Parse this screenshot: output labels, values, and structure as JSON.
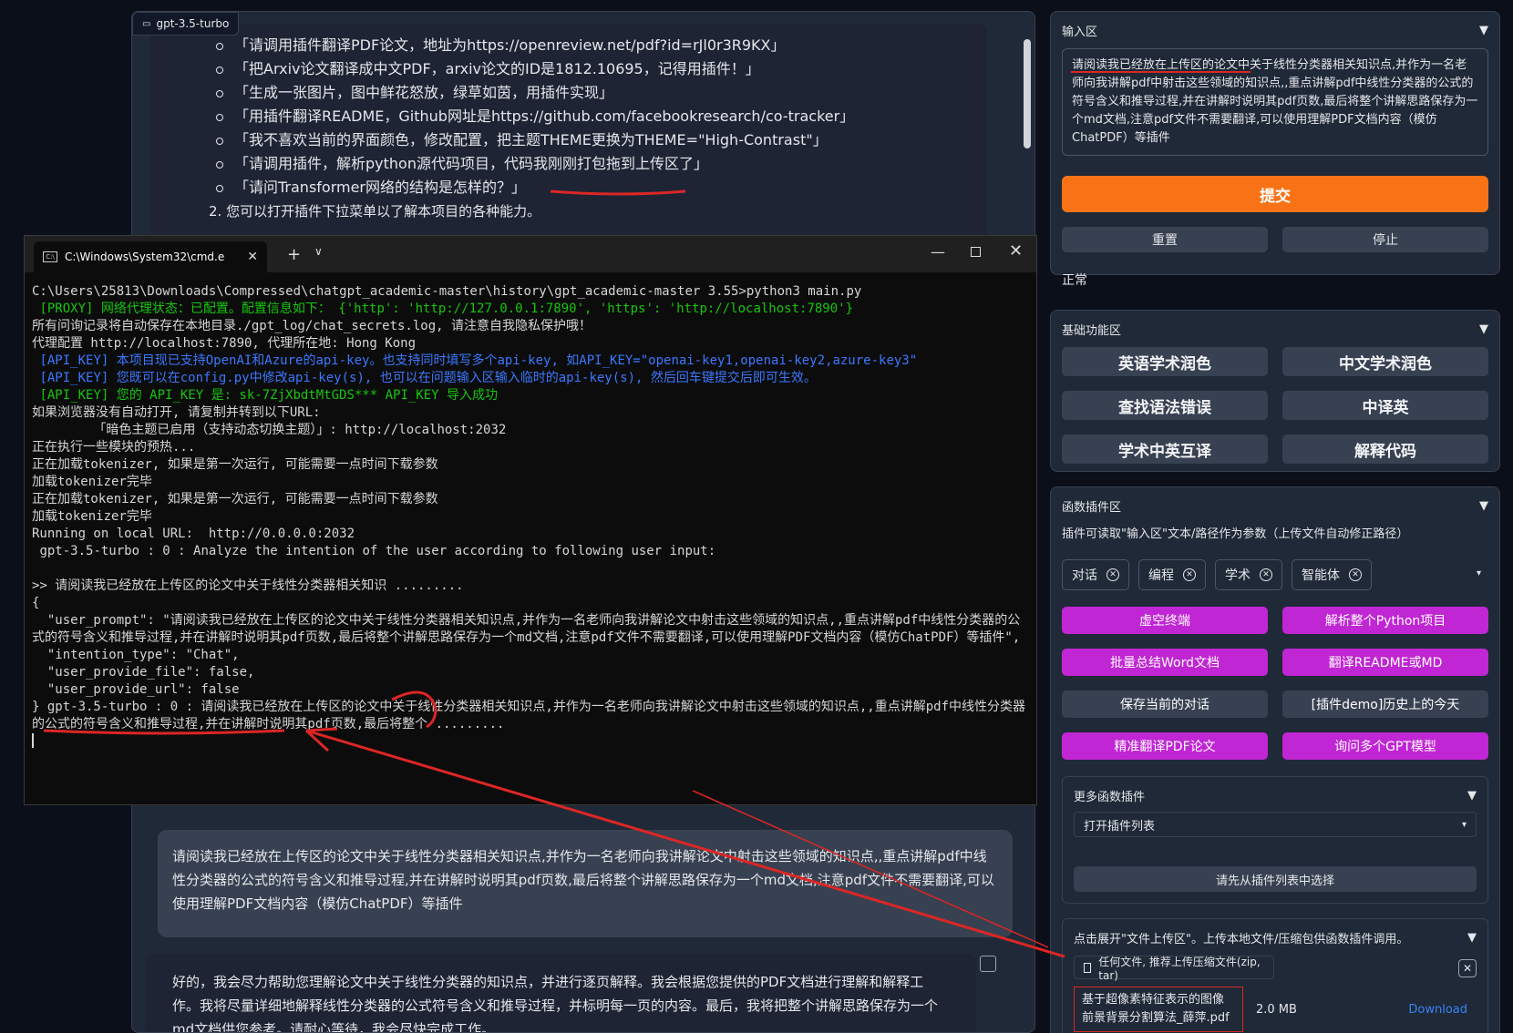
{
  "chat": {
    "label": "gpt-3.5-turbo",
    "examples": [
      "「请调用插件翻译PDF论文，地址为https://openreview.net/pdf?id=rJl0r3R9KX」",
      "「把Arxiv论文翻译成中文PDF，arxiv论文的ID是1812.10695，记得用插件！」",
      "「生成一张图片，图中鲜花怒放，绿草如茵，用插件实现」",
      "「用插件翻译README，Github网址是https://github.com/facebookresearch/co-tracker」",
      "「我不喜欢当前的界面颜色，修改配置，把主题THEME更换为THEME=\"High-Contrast\"」",
      "「请调用插件，解析python源代码项目，代码我刚刚打包拖到上传区了」",
      "「请问Transformer网络的结构是怎样的？」"
    ],
    "point_two": "2. 您可以打开插件下拉菜单以了解本项目的各种能力。",
    "user_message": "请阅读我已经放在上传区的论文中关于线性分类器相关知识点,并作为一名老师向我讲解论文中射击这些领域的知识点,,重点讲解pdf中线性分类器的公式的符号含义和推导过程,并在讲解时说明其pdf页数,最后将整个讲解思路保存为一个md文档,注意pdf文件不需要翻译,可以使用理解PDF文档内容（模仿ChatPDF）等插件",
    "bot_message": "好的，我会尽力帮助您理解论文中关于线性分类器的知识点，并进行逐页解释。我会根据您提供的PDF文档进行理解和解释工作。我将尽量详细地解释线性分类器的公式符号含义和推导过程，并标明每一页的内容。最后，我将把整个讲解思路保存为一个md文档供您参考。请耐心等待，我会尽快完成工作。"
  },
  "cmd": {
    "tab_title": "C:\\Windows\\System32\\cmd.e",
    "tab_icon_text": "C:\\",
    "lines": [
      {
        "t": "C:\\Users\\25813\\Downloads\\Compressed\\chatgpt_academic-master\\history\\gpt_academic-master 3.55>python3 main.py",
        "c": ""
      },
      {
        "t": " [PROXY] 网络代理状态：已配置。配置信息如下： {'http': 'http://127.0.0.1:7890', 'https': 'http://localhost:7890'}",
        "c": "g"
      },
      {
        "t": "所有问询记录将自动保存在本地目录./gpt_log/chat_secrets.log, 请注意自我隐私保护哦！",
        "c": ""
      },
      {
        "t": "代理配置 http://localhost:7890, 代理所在地: Hong Kong",
        "c": ""
      },
      {
        "t": " [API_KEY] 本项目现已支持OpenAI和Azure的api-key。也支持同时填写多个api-key, 如API_KEY=\"openai-key1,openai-key2,azure-key3\"",
        "c": "b"
      },
      {
        "t": " [API_KEY] 您既可以在config.py中修改api-key(s), 也可以在问题输入区输入临时的api-key(s), 然后回车键提交后即可生效。",
        "c": "b"
      },
      {
        "t": " [API_KEY] 您的 API_KEY 是: sk-7ZjXbdtMtGDS*** API_KEY 导入成功",
        "c": "g"
      },
      {
        "t": "如果浏览器没有自动打开, 请复制并转到以下URL:",
        "c": ""
      },
      {
        "t": "        「暗色主题已启用（支持动态切换主题）」: http://localhost:2032",
        "c": ""
      },
      {
        "t": "正在执行一些模块的预热...",
        "c": ""
      },
      {
        "t": "正在加载tokenizer, 如果是第一次运行, 可能需要一点时间下载参数",
        "c": ""
      },
      {
        "t": "加载tokenizer完毕",
        "c": ""
      },
      {
        "t": "正在加载tokenizer, 如果是第一次运行, 可能需要一点时间下载参数",
        "c": ""
      },
      {
        "t": "加载tokenizer完毕",
        "c": ""
      },
      {
        "t": "Running on local URL:  http://0.0.0.0:2032",
        "c": ""
      },
      {
        "t": " gpt-3.5-turbo : 0 : Analyze the intention of the user according to following user input:",
        "c": ""
      },
      {
        "t": " ",
        "c": ""
      },
      {
        "t": ">> 请阅读我已经放在上传区的论文中关于线性分类器相关知识 .........",
        "c": ""
      },
      {
        "t": "{",
        "c": ""
      },
      {
        "t": "  \"user_prompt\": \"请阅读我已经放在上传区的论文中关于线性分类器相关知识点,并作为一名老师向我讲解论文中射击这些领域的知识点,,重点讲解pdf中线性分类器的公式的符号含义和推导过程,并在讲解时说明其pdf页数,最后将整个讲解思路保存为一个md文档,注意pdf文件不需要翻译,可以使用理解PDF文档内容（模仿ChatPDF）等插件\",",
        "c": ""
      },
      {
        "t": "  \"intention_type\": \"Chat\",",
        "c": ""
      },
      {
        "t": "  \"user_provide_file\": false,",
        "c": ""
      },
      {
        "t": "  \"user_provide_url\": false",
        "c": ""
      },
      {
        "t": "} gpt-3.5-turbo : 0 : 请阅读我已经放在上传区的论文中关于线性分类器相关知识点,并作为一名老师向我讲解论文中射击这些领域的知识点,,重点讲解pdf中线性分类器的公式的符号含义和推导过程,并在讲解时说明其pdf页数,最后将整个 .........",
        "c": ""
      }
    ]
  },
  "input_panel": {
    "title": "输入区",
    "text": "请阅读我已经放在上传区的论文中关于线性分类器相关知识点,并作为一名老师向我讲解pdf中射击这些领域的知识点,,重点讲解pdf中线性分类器的公式的符号含义和推导过程,并在讲解时说明其pdf页数,最后将整个讲解思路保存为一个md文档,注意pdf文件不需要翻译,可以使用理解PDF文档内容（模仿ChatPDF）等插件",
    "submit": "提交",
    "reset": "重置",
    "stop": "停止",
    "status": "正常"
  },
  "basic_panel": {
    "title": "基础功能区",
    "buttons": [
      "英语学术润色",
      "中文学术润色",
      "查找语法错误",
      "中译英",
      "学术中英互译",
      "解释代码"
    ]
  },
  "plugin_panel": {
    "title": "函数插件区",
    "desc": "插件可读取\"输入区\"文本/路径作为参数（上传文件自动修正路径）",
    "tags": [
      "对话",
      "编程",
      "学术",
      "智能体"
    ],
    "buttons": [
      "虚空终端",
      "解析整个Python项目",
      "批量总结Word文档",
      "翻译README或MD",
      "保存当前的对话",
      "[插件demo]历史上的今天",
      "精准翻译PDF论文",
      "询问多个GPT模型"
    ],
    "more_title": "更多函数插件",
    "select_value": "打开插件列表",
    "select_first": "请先从插件列表中选择",
    "upload_title": "点击展开\"文件上传区\"。上传本地文件/压缩包供函数插件调用。",
    "upload_label": "任何文件, 推荐上传压缩文件(zip, tar)",
    "file_name": "基于超像素特征表示的图像前景背景分割算法_薛萍.pdf",
    "file_size": "2.0 MB",
    "download": "Download"
  },
  "colors": {
    "accent": "#f97316",
    "plugin": "#c026d3",
    "annotation": "#dc2626"
  }
}
